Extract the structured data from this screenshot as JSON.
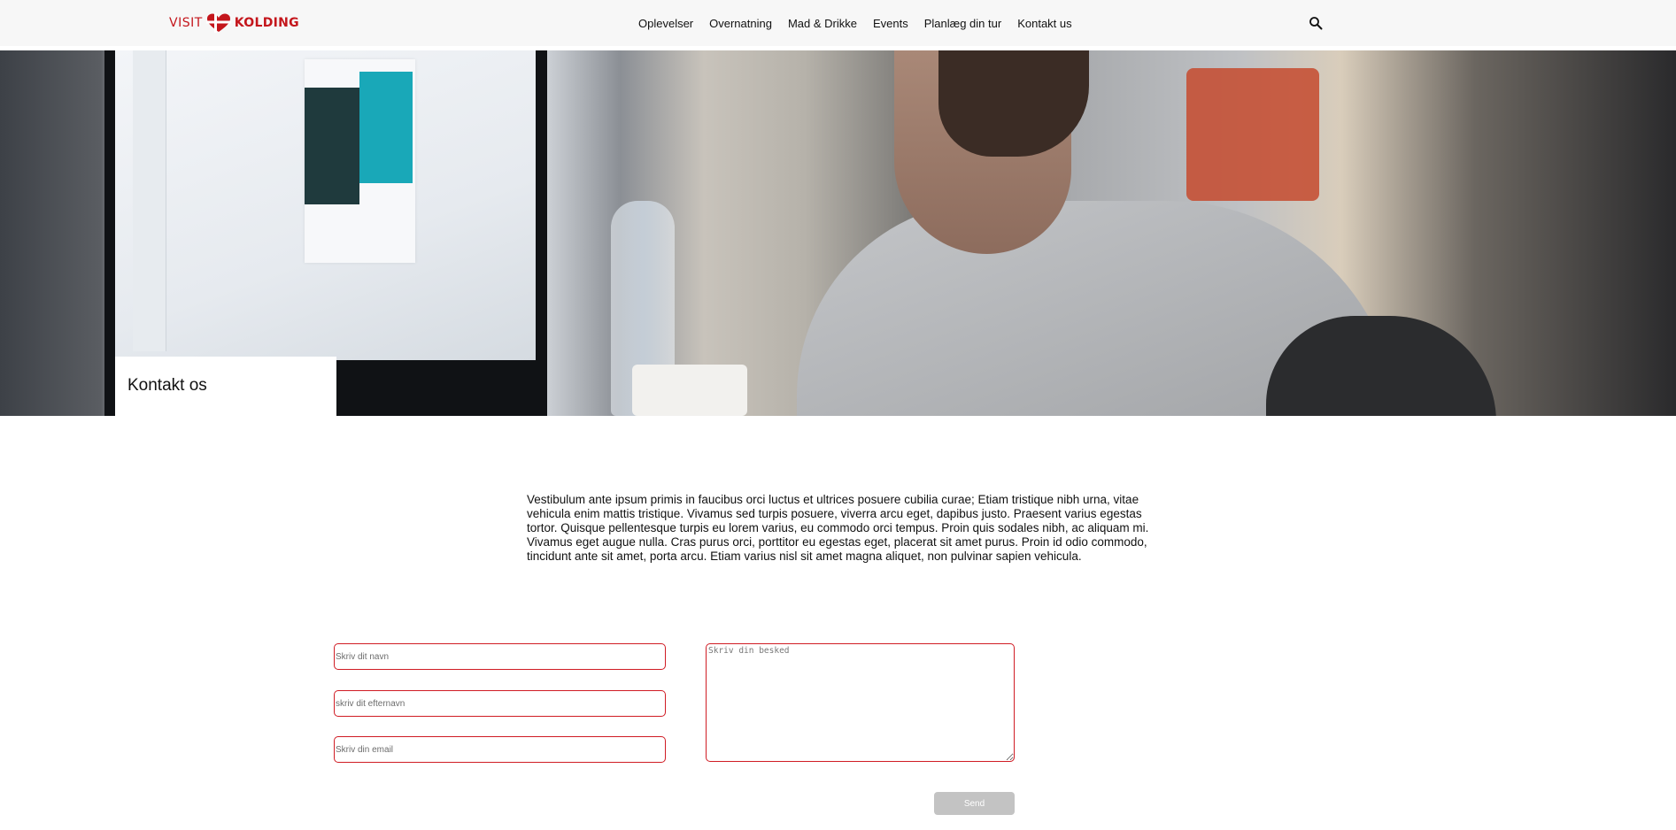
{
  "header": {
    "logo": {
      "left_text": "VISIT",
      "right_text": "KOLDING",
      "brand_color": "#c4161c"
    },
    "nav": [
      {
        "label": "Oplevelser"
      },
      {
        "label": "Overnatning"
      },
      {
        "label": "Mad & Drikke"
      },
      {
        "label": "Events"
      },
      {
        "label": "Planlæg din tur"
      },
      {
        "label": "Kontakt us"
      }
    ],
    "search_icon": "search-icon"
  },
  "hero": {
    "title": "Kontakt os"
  },
  "intro": {
    "text": "Vestibulum ante ipsum primis in faucibus orci luctus et ultrices posuere cubilia curae; Etiam tristique nibh urna, vitae vehicula enim mattis tristique. Vivamus sed turpis posuere, viverra arcu eget, dapibus justo. Praesent varius egestas tortor. Quisque pellentesque turpis eu lorem varius, eu commodo orci tempus. Proin quis sodales nibh, ac aliquam mi. Vivamus eget augue nulla. Cras purus orci, porttitor eu egestas eget, placerat sit amet purus. Proin id odio commodo, tincidunt ante sit amet, porta arcu. Etiam varius nisl sit amet magna aliquet, non pulvinar sapien vehicula."
  },
  "form": {
    "first_name_placeholder": "Skriv dit navn",
    "last_name_placeholder": "skriv dit efternavn",
    "email_placeholder": "Skriv din email",
    "message_placeholder": "Skriv din besked",
    "send_label": "Send",
    "field_border_color": "#d01c24",
    "send_button_color": "#c3c3c3"
  }
}
